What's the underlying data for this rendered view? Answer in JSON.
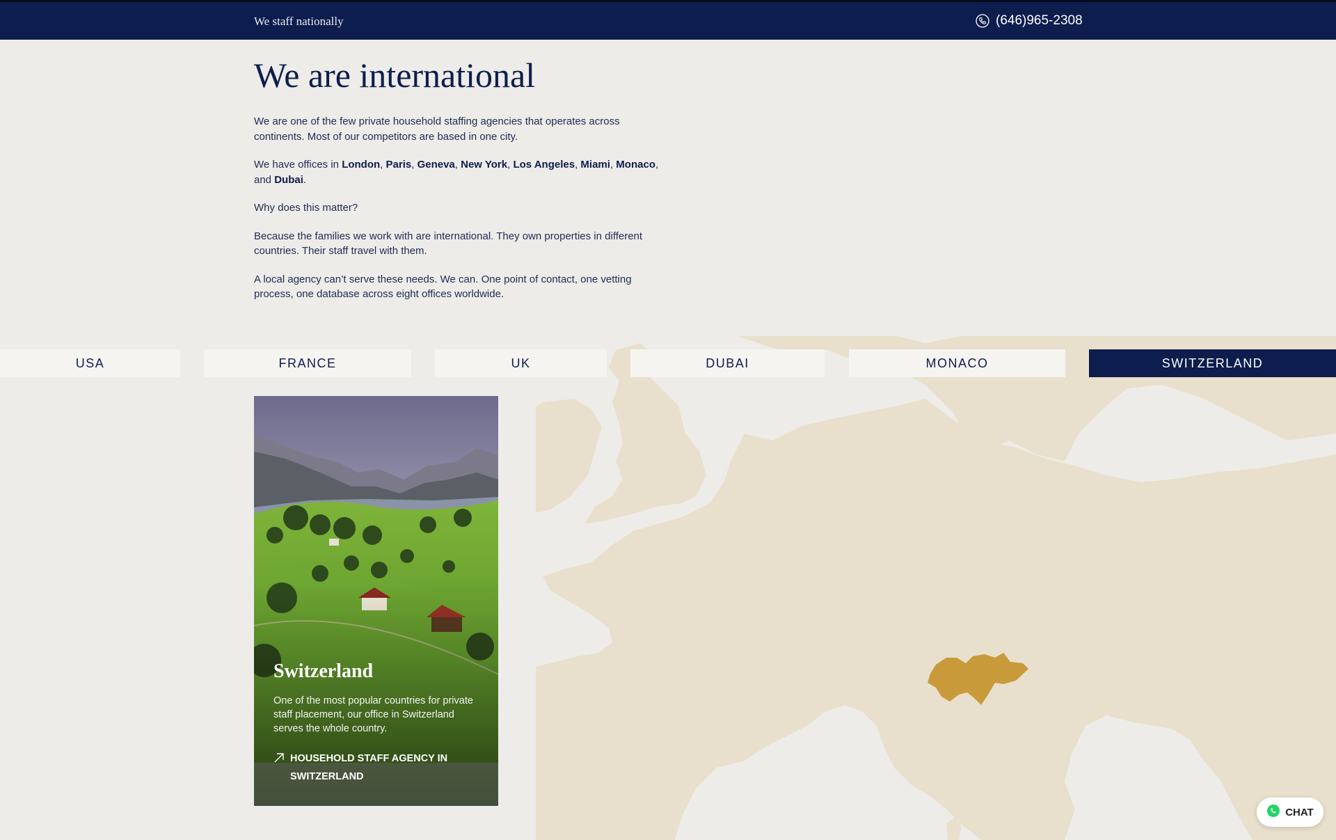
{
  "topbar": {
    "tagline": "We staff nationally",
    "phone": "(646)965-2308"
  },
  "intro": {
    "heading": "We are international",
    "p1": "We are one of the few private household staffing agencies that operates across continents. Most of our competitors are based in one city.",
    "p2_prefix": "We have offices in ",
    "offices": [
      "London",
      "Paris",
      "Geneva",
      "New York",
      "Los Angeles",
      "Miami",
      "Monaco",
      "Dubai"
    ],
    "p2_sep": ", ",
    "p2_and": ", and ",
    "p2_end": ".",
    "p3": "Why does this matter?",
    "p4": "Because the families we work with are international. They own properties in different countries. Their staff travel with them.",
    "p5": "A local agency can’t serve these needs. We can. One point of contact, one vetting process, one database across eight offices worldwide."
  },
  "tabs": [
    {
      "label": "USA",
      "active": false
    },
    {
      "label": "FRANCE",
      "active": false
    },
    {
      "label": "UK",
      "active": false
    },
    {
      "label": "DUBAI",
      "active": false
    },
    {
      "label": "MONACO",
      "active": false
    },
    {
      "label": "SWITZERLAND",
      "active": true
    }
  ],
  "card": {
    "title": "Switzerland",
    "text": "One of the most popular countries for private staff placement, our office in Switzerland serves the whole country.",
    "link": "Household staff agency in Switzerland"
  },
  "map": {
    "highlighted_country": "Switzerland",
    "land_color": "#e8e0cc",
    "highlight_color": "#c99a3a"
  },
  "chat": {
    "label": "CHAT"
  },
  "colors": {
    "navy": "#0d1d4d",
    "background": "#eeece8"
  }
}
